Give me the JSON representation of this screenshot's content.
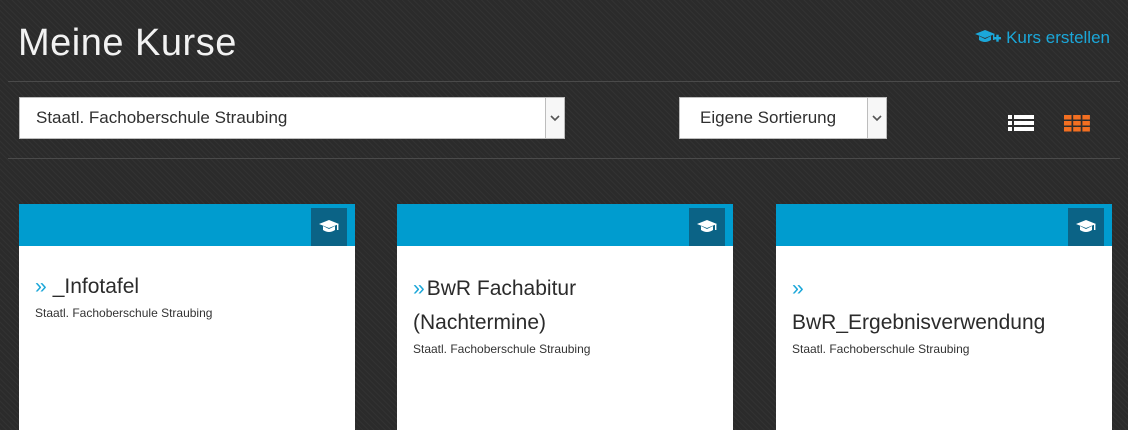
{
  "header": {
    "title": "Meine Kurse",
    "create_label": "Kurs erstellen",
    "create_icon": "graduation-cap-plus-icon"
  },
  "filters": {
    "school_select": {
      "value": "Staatl. Fachoberschule Straubing"
    },
    "sort_select": {
      "value": "Eigene Sortierung"
    }
  },
  "view_toggle": {
    "list_icon": "list-view-icon",
    "grid_icon": "grid-view-icon",
    "active": "grid"
  },
  "colors": {
    "accent": "#1ba7d9",
    "band": "#009ccf",
    "cap_box": "#0b6386",
    "grid_active": "#f36f21"
  },
  "courses": [
    {
      "chevron": "»",
      "name": "_Infotafel",
      "school": "Staatl. Fachoberschule Straubing"
    },
    {
      "chevron": "»",
      "name": "BwR Fachabitur (Nachtermine)",
      "school": "Staatl. Fachoberschule Straubing"
    },
    {
      "chevron": "»",
      "name": "BwR_Ergebnisverwendung",
      "school": "Staatl. Fachoberschule Straubing"
    }
  ]
}
